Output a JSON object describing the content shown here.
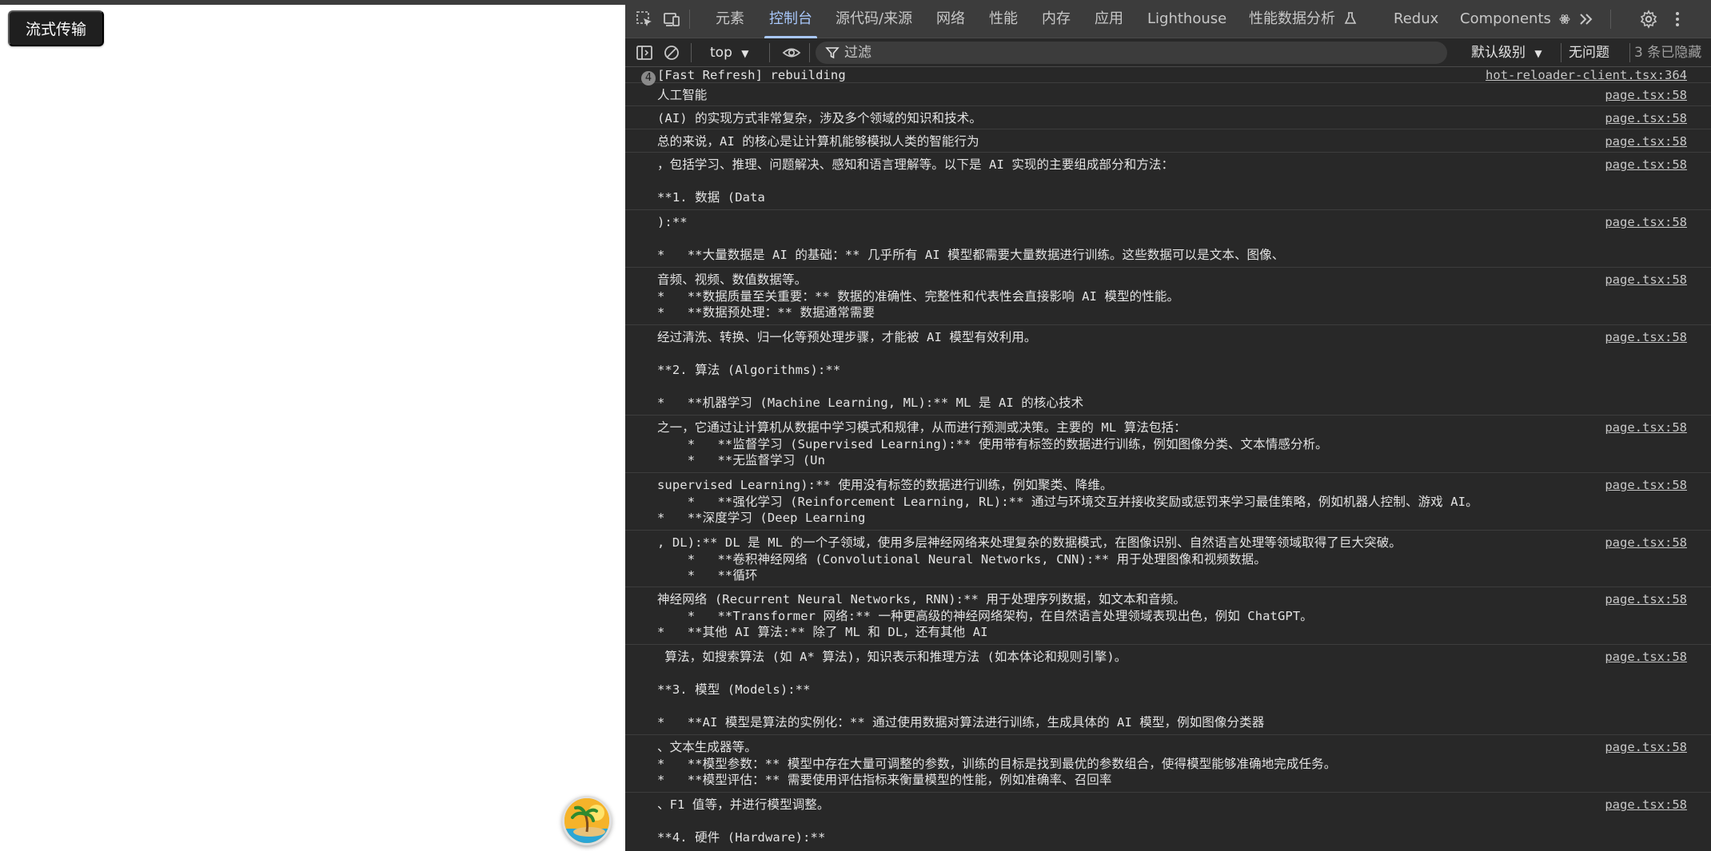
{
  "page": {
    "stream_button": "流式传输"
  },
  "devtools": {
    "tabs": [
      {
        "label": "元素"
      },
      {
        "label": "控制台",
        "active": true
      },
      {
        "label": "源代码/来源"
      },
      {
        "label": "网络"
      },
      {
        "label": "性能"
      },
      {
        "label": "内存"
      },
      {
        "label": "应用"
      },
      {
        "label": "Lighthouse"
      },
      {
        "label": "性能数据分析"
      },
      {
        "label": "Redux"
      },
      {
        "label": "Components"
      }
    ],
    "toolbar": {
      "context": "top",
      "filter_placeholder": "过滤",
      "level": "默认级别",
      "issues": "无问题",
      "hidden_count": "3 条已隐藏"
    },
    "console": {
      "messages": [
        {
          "count": "4",
          "text": "[Fast Refresh] rebuilding",
          "source": "hot-reloader-client.tsx:364"
        },
        {
          "text": "人工智能",
          "source": "page.tsx:58"
        },
        {
          "text": "(AI) 的实现方式非常复杂，涉及多个领域的知识和技术。",
          "source": "page.tsx:58"
        },
        {
          "text": "总的来说，AI 的核心是让计算机能够模拟人类的智能行为",
          "source": "page.tsx:58"
        },
        {
          "text": "，包括学习、推理、问题解决、感知和语言理解等。以下是 AI 实现的主要组成部分和方法：\n\n**1. 数据 (Data",
          "source": "page.tsx:58"
        },
        {
          "text": "):**\n\n*   **大量数据是 AI 的基础：** 几乎所有 AI 模型都需要大量数据进行训练。这些数据可以是文本、图像、",
          "source": "page.tsx:58"
        },
        {
          "text": "音频、视频、数值数据等。\n*   **数据质量至关重要：** 数据的准确性、完整性和代表性会直接影响 AI 模型的性能。\n*   **数据预处理：** 数据通常需要",
          "source": "page.tsx:58"
        },
        {
          "text": "经过清洗、转换、归一化等预处理步骤，才能被 AI 模型有效利用。\n\n**2. 算法 (Algorithms):**\n\n*   **机器学习 (Machine Learning, ML):** ML 是 AI 的核心技术",
          "source": "page.tsx:58"
        },
        {
          "text": "之一，它通过让计算机从数据中学习模式和规律，从而进行预测或决策。主要的 ML 算法包括：\n    *   **监督学习 (Supervised Learning):** 使用带有标签的数据进行训练，例如图像分类、文本情感分析。\n    *   **无监督学习 (Un",
          "source": "page.tsx:58"
        },
        {
          "text": "supervised Learning):** 使用没有标签的数据进行训练，例如聚类、降维。\n    *   **强化学习 (Reinforcement Learning, RL):** 通过与环境交互并接收奖励或惩罚来学习最佳策略，例如机器人控制、游戏 AI。\n*   **深度学习 (Deep Learning",
          "source": "page.tsx:58"
        },
        {
          "text": ", DL):** DL 是 ML 的一个子领域，使用多层神经网络来处理复杂的数据模式，在图像识别、自然语言处理等领域取得了巨大突破。\n    *   **卷积神经网络 (Convolutional Neural Networks, CNN):** 用于处理图像和视频数据。\n    *   **循环",
          "source": "page.tsx:58"
        },
        {
          "text": "神经网络 (Recurrent Neural Networks, RNN):** 用于处理序列数据，如文本和音频。\n    *   **Transformer 网络:** 一种更高级的神经网络架构，在自然语言处理领域表现出色，例如 ChatGPT。\n*   **其他 AI 算法:** 除了 ML 和 DL，还有其他 AI",
          "source": "page.tsx:58"
        },
        {
          "text": " 算法，如搜索算法 (如 A* 算法)，知识表示和推理方法 (如本体论和规则引擎)。\n\n**3. 模型 (Models):**\n\n*   **AI 模型是算法的实例化：** 通过使用数据对算法进行训练，生成具体的 AI 模型，例如图像分类器",
          "source": "page.tsx:58"
        },
        {
          "text": "、文本生成器等。\n*   **模型参数：** 模型中存在大量可调整的参数，训练的目标是找到最优的参数组合，使得模型能够准确地完成任务。\n*   **模型评估：** 需要使用评估指标来衡量模型的性能，例如准确率、召回率",
          "source": "page.tsx:58"
        },
        {
          "text": "、F1 值等，并进行模型调整。\n\n**4. 硬件 (Hardware):**",
          "source": "page.tsx:58"
        }
      ]
    }
  }
}
